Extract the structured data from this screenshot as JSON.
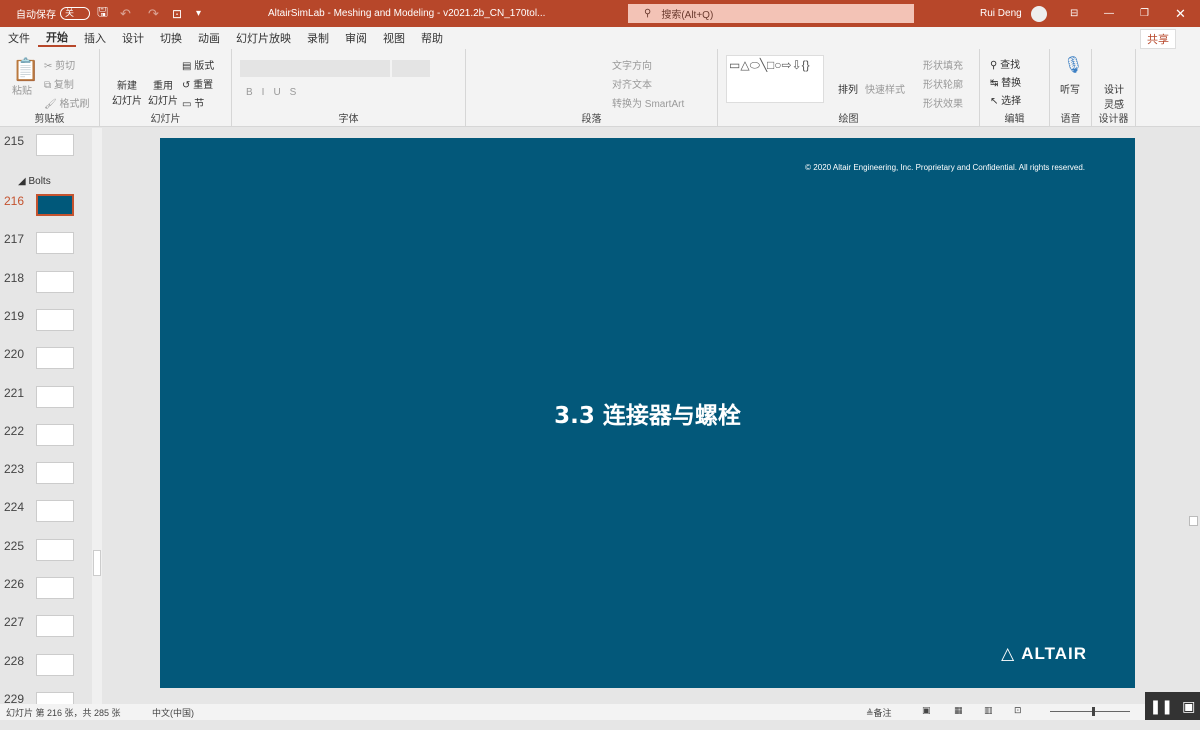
{
  "titlebar": {
    "autosave_label": "自动保存",
    "autosave_state": "关",
    "doc_title": "AltairSimLab - Meshing and Modeling - v2021.2b_CN_170tol...",
    "search_placeholder": "搜索(Alt+Q)",
    "user": "Rui Deng"
  },
  "tabs": [
    "文件",
    "开始",
    "插入",
    "设计",
    "切换",
    "动画",
    "幻灯片放映",
    "录制",
    "审阅",
    "视图",
    "帮助"
  ],
  "ribbon": {
    "clipboard": {
      "paste": "粘贴",
      "cut": "剪切",
      "copy": "复制",
      "format_painter": "格式刷",
      "label": "剪贴板"
    },
    "slides": {
      "new_slide": "新建\n幻灯片",
      "reuse": "重用\n幻灯片",
      "layout": "版式",
      "reset": "重置",
      "section": "节",
      "label": "幻灯片"
    },
    "font": {
      "label": "字体"
    },
    "paragraph": {
      "text_direction": "文字方向",
      "align_text": "对齐文本",
      "smartart": "转换为 SmartArt",
      "label": "段落"
    },
    "drawing": {
      "arrange": "排列",
      "quick_styles": "快速样式",
      "fill": "形状填充",
      "outline": "形状轮廓",
      "effects": "形状效果",
      "label": "绘图"
    },
    "editing": {
      "find": "查找",
      "replace": "替换",
      "select": "选择",
      "label": "编辑"
    },
    "voice": {
      "dictate": "听写",
      "label": "语音"
    },
    "designer": {
      "ideas": "设计\n灵感",
      "label": "设计器"
    },
    "share": "共享"
  },
  "panel": {
    "section": "Bolts",
    "slides": [
      "215",
      "216",
      "217",
      "218",
      "219",
      "220",
      "221",
      "222",
      "223",
      "224",
      "225",
      "226",
      "227",
      "228",
      "229"
    ]
  },
  "slide": {
    "copyright": "© 2020 Altair Engineering, Inc. Proprietary and Confidential. All rights reserved.",
    "title": "3.3 连接器与螺栓",
    "logo": "ALTAIR"
  },
  "status": {
    "slide_info": "幻灯片 第 216 张，共 285 张",
    "language": "中文(中国)",
    "notes": "备注"
  }
}
